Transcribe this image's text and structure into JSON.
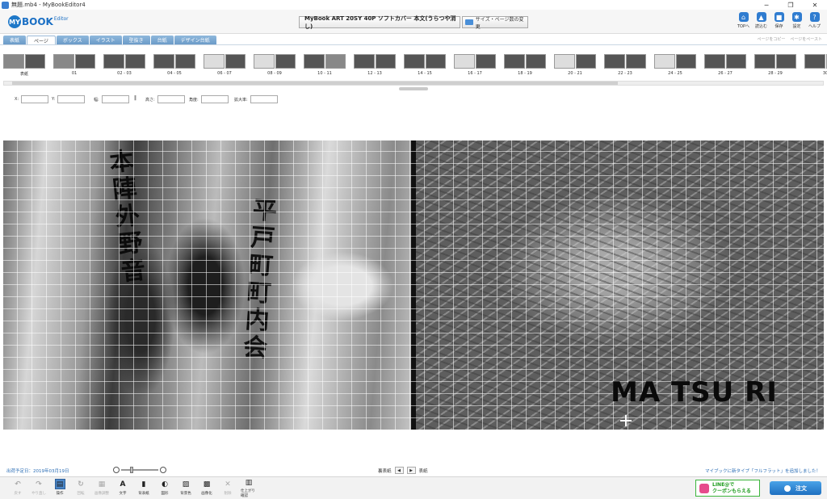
{
  "window": {
    "title": "無題.mb4 - MyBookEditor4",
    "controls": [
      "─",
      "❐",
      "✕"
    ]
  },
  "logo": {
    "my": "MY",
    "book": "BOOK",
    "editor": "Editor"
  },
  "product": {
    "name": "MyBook ART 20SY 40P ソフトカバー 本文(うらつや消し)"
  },
  "size_button": {
    "label": "サイズ・ページ数の変更"
  },
  "header_tools": [
    {
      "label": "TOPへ",
      "icon": "home-icon",
      "glyph": "⌂"
    },
    {
      "label": "読込む",
      "icon": "open-icon",
      "glyph": "▲"
    },
    {
      "label": "保存",
      "icon": "save-icon",
      "glyph": "■"
    },
    {
      "label": "設定",
      "icon": "gear-icon",
      "glyph": "✱"
    },
    {
      "label": "ヘルプ",
      "icon": "help-icon",
      "glyph": "?"
    }
  ],
  "tabs": [
    {
      "label": "表紙",
      "active": false
    },
    {
      "label": "ページ",
      "active": true
    },
    {
      "label": "ボックス",
      "active": false
    },
    {
      "label": "イラスト",
      "active": false
    },
    {
      "label": "型抜き",
      "active": false
    },
    {
      "label": "台紙",
      "active": false
    },
    {
      "label": "デザイン台紙",
      "active": false
    }
  ],
  "page_actions": {
    "copy": "ページをコピー",
    "paste": "ページをペースト"
  },
  "thumbnails": [
    {
      "label": "表紙",
      "tones": [
        "mid",
        "dark"
      ]
    },
    {
      "label": "01",
      "tones": [
        "mid",
        "dark"
      ]
    },
    {
      "label": "02 - 03",
      "tones": [
        "dark",
        "dark"
      ]
    },
    {
      "label": "04 - 05",
      "tones": [
        "dark",
        "dark"
      ]
    },
    {
      "label": "06 - 07",
      "tones": [
        "light",
        "dark"
      ]
    },
    {
      "label": "08 - 09",
      "tones": [
        "light",
        "dark"
      ]
    },
    {
      "label": "10 - 11",
      "tones": [
        "dark",
        "mid"
      ]
    },
    {
      "label": "12 - 13",
      "tones": [
        "dark",
        "dark"
      ]
    },
    {
      "label": "14 - 15",
      "tones": [
        "dark",
        "dark"
      ]
    },
    {
      "label": "16 - 17",
      "tones": [
        "light",
        "dark"
      ]
    },
    {
      "label": "18 - 19",
      "tones": [
        "dark",
        "dark"
      ]
    },
    {
      "label": "20 - 21",
      "tones": [
        "light",
        "dark"
      ]
    },
    {
      "label": "22 - 23",
      "tones": [
        "dark",
        "dark"
      ]
    },
    {
      "label": "24 - 25",
      "tones": [
        "light",
        "dark"
      ]
    },
    {
      "label": "26 - 27",
      "tones": [
        "dark",
        "dark"
      ]
    },
    {
      "label": "28 - 29",
      "tones": [
        "dark",
        "dark"
      ]
    },
    {
      "label": "30",
      "tones": [
        "dark",
        "dark"
      ]
    }
  ],
  "properties": {
    "x_label": "X:",
    "y_label": "Y:",
    "width_label": "幅:",
    "height_label": "高さ:",
    "angle_label": "角度:",
    "scale_label": "拡大率:",
    "x": "",
    "y": "",
    "width": "",
    "height": "",
    "angle": "",
    "scale": ""
  },
  "canvas": {
    "left_text_1": "本陣外野音",
    "left_text_2": "平戸町町内会",
    "right_text": "MA TSU RI"
  },
  "status": {
    "ship_date": "出荷予定日：2019年03月19日",
    "zoom_level": 0.25,
    "page_prev": "裏表紙",
    "page_next": "表紙",
    "news": "マイブックに新タイプ「フルフラット」を追加しました！"
  },
  "toolbar": [
    {
      "label": "戻す",
      "icon": "undo-icon",
      "glyph": "↶",
      "enabled": false
    },
    {
      "label": "やり直し",
      "icon": "redo-icon",
      "glyph": "↷",
      "enabled": false
    },
    {
      "label": "操作",
      "icon": "operate-icon",
      "glyph": "▤",
      "enabled": true,
      "active": true
    },
    {
      "label": "回転",
      "icon": "rotate-icon",
      "glyph": "↻",
      "enabled": false
    },
    {
      "label": "画像調整",
      "icon": "image-adjust-icon",
      "glyph": "▦",
      "enabled": false
    },
    {
      "label": "文字",
      "icon": "text-icon",
      "glyph": "A",
      "enabled": true
    },
    {
      "label": "背表紙",
      "icon": "spine-icon",
      "glyph": "▮",
      "enabled": true
    },
    {
      "label": "図形",
      "icon": "shape-icon",
      "glyph": "◐",
      "enabled": true
    },
    {
      "label": "背景色",
      "icon": "bg-color-icon",
      "glyph": "▨",
      "enabled": true
    },
    {
      "label": "画像化",
      "icon": "rasterize-icon",
      "glyph": "▩",
      "enabled": true
    },
    {
      "label": "削除",
      "icon": "trash-icon",
      "glyph": "✕",
      "enabled": false
    },
    {
      "label": "仕上がり確認",
      "icon": "preview-icon",
      "glyph": "▥",
      "enabled": true
    }
  ],
  "line_banner": {
    "line1": "LINE@で",
    "line2": "クーポンもらえる"
  },
  "order_button": {
    "label": "注文"
  }
}
